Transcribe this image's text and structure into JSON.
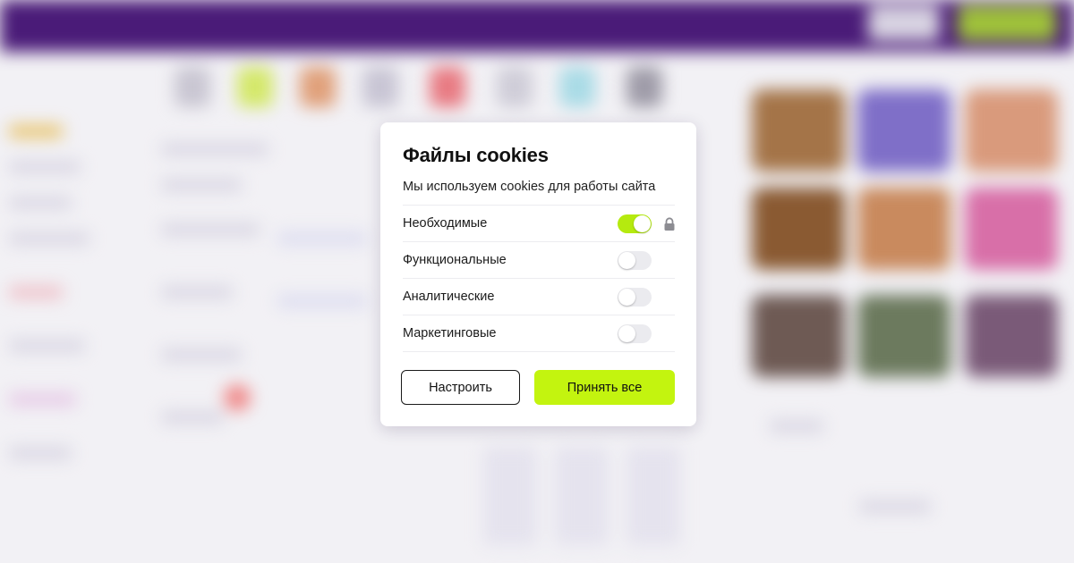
{
  "colors": {
    "accent": "#c3f40f",
    "toggle_on": "#b5ea0f",
    "header_bg": "#4a1b78"
  },
  "cookie_modal": {
    "title": "Файлы cookies",
    "subtitle": "Мы используем cookies для работы сайта",
    "categories": [
      {
        "label": "Необходимые",
        "enabled": true,
        "locked": true
      },
      {
        "label": "Функциональные",
        "enabled": false,
        "locked": false
      },
      {
        "label": "Аналитические",
        "enabled": false,
        "locked": false
      },
      {
        "label": "Маркетинговые",
        "enabled": false,
        "locked": false
      }
    ],
    "customize_label": "Настроить",
    "accept_all_label": "Принять все"
  }
}
